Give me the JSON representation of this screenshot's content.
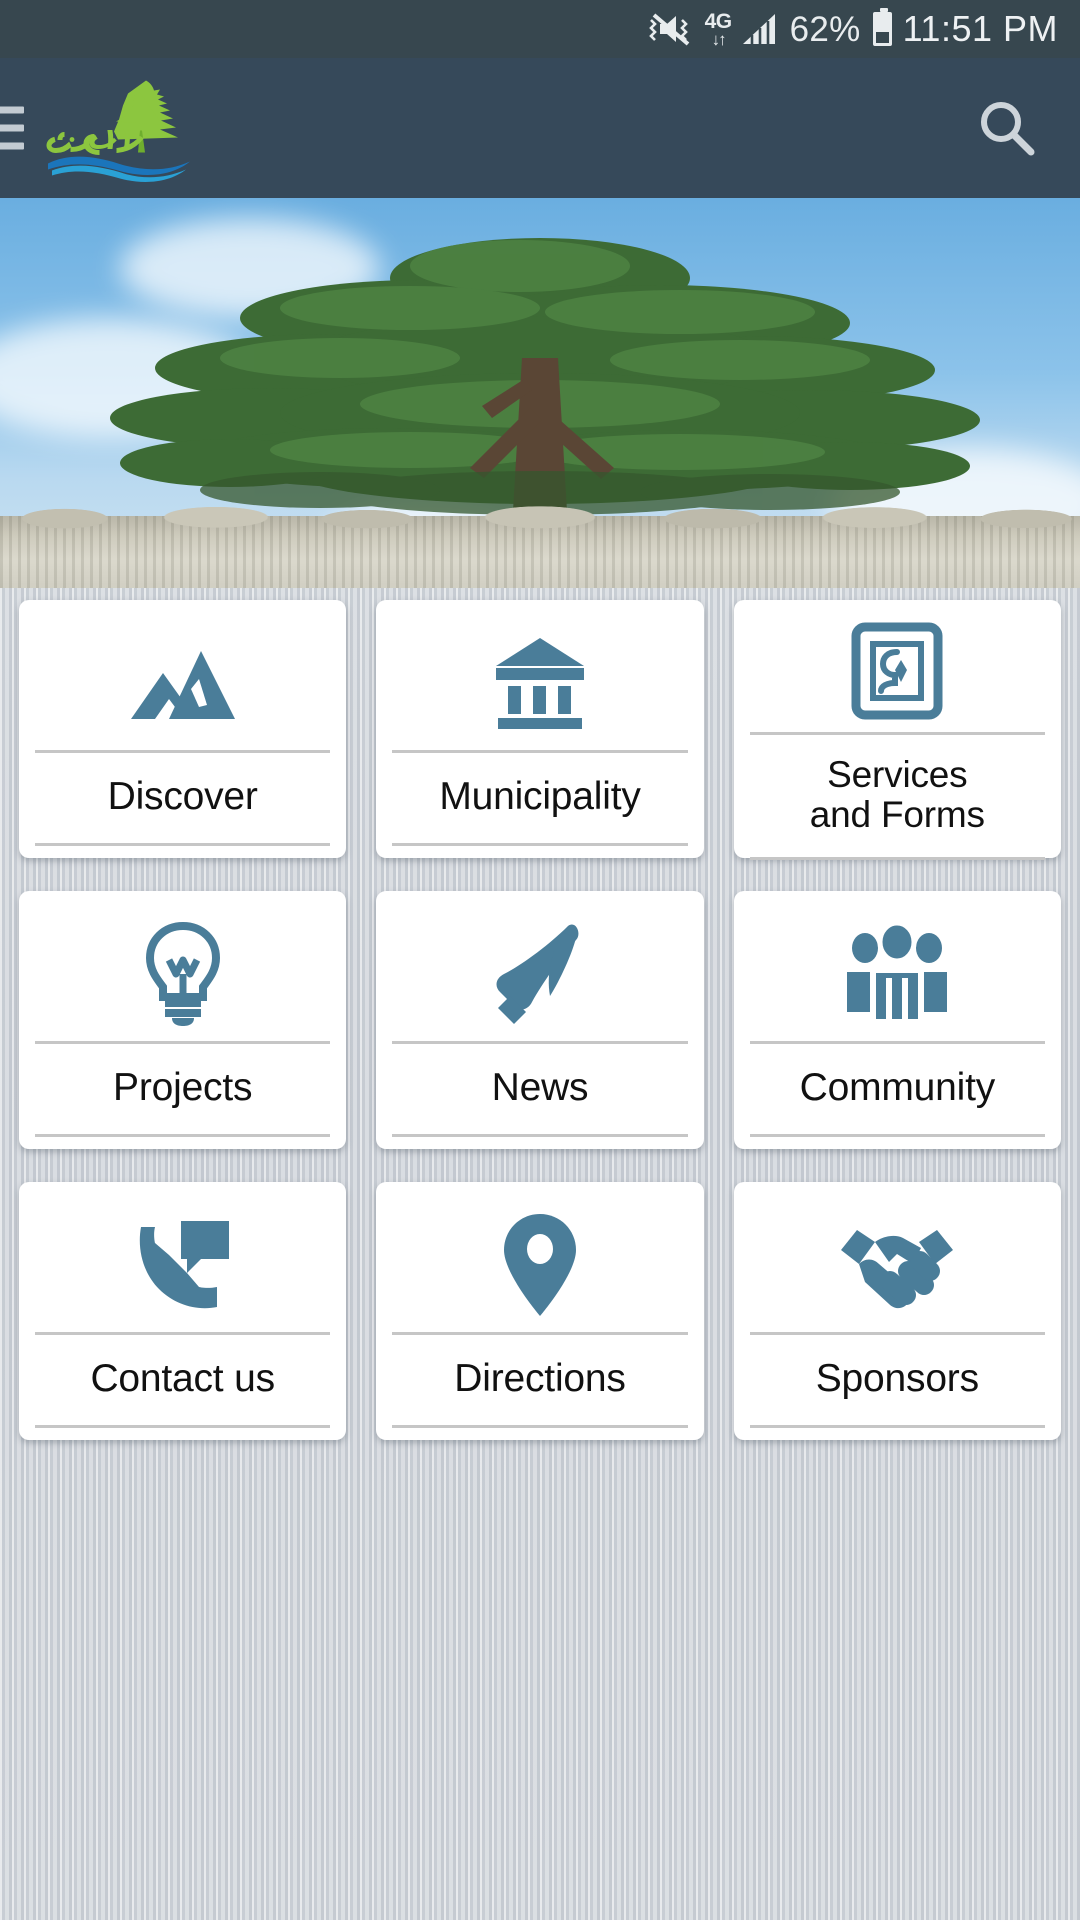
{
  "statusbar": {
    "vibrate_icon": "vibrate-mute-icon",
    "network_label": "4G",
    "network_arrows": "↓↑",
    "signal_icon": "signal-bars-icon",
    "battery_percent": "62%",
    "battery_icon": "battery-icon",
    "time": "11:51 PM"
  },
  "header": {
    "menu_icon": "hamburger-menu-icon",
    "logo_name": "dhour-el-choueir-cedar-logo",
    "logo_alt": "دهور الشوير",
    "search_icon": "search-icon",
    "bg_color": "#36495a"
  },
  "hero": {
    "name": "cedar-tree-hero-image",
    "alt": "Cedar tree above a stone wall against blue sky"
  },
  "theme": {
    "icon_color": "#4a7d99",
    "statusbar_color": "#37474f",
    "tile_bg": "#ffffff",
    "divider_color": "#c6c6c6"
  },
  "tiles": [
    {
      "label": "Discover",
      "icon": "mountains-icon",
      "two_line": false
    },
    {
      "label": "Municipality",
      "icon": "bank-icon",
      "two_line": false
    },
    {
      "label": "Services\nand Forms",
      "icon": "form-device-icon",
      "two_line": true
    },
    {
      "label": "Projects",
      "icon": "lightbulb-icon",
      "two_line": false
    },
    {
      "label": "News",
      "icon": "megaphone-icon",
      "two_line": false
    },
    {
      "label": "Community",
      "icon": "people-group-icon",
      "two_line": false
    },
    {
      "label": "Contact us",
      "icon": "phone-message-icon",
      "two_line": false
    },
    {
      "label": "Directions",
      "icon": "map-pin-icon",
      "two_line": false
    },
    {
      "label": "Sponsors",
      "icon": "handshake-icon",
      "two_line": false
    }
  ]
}
